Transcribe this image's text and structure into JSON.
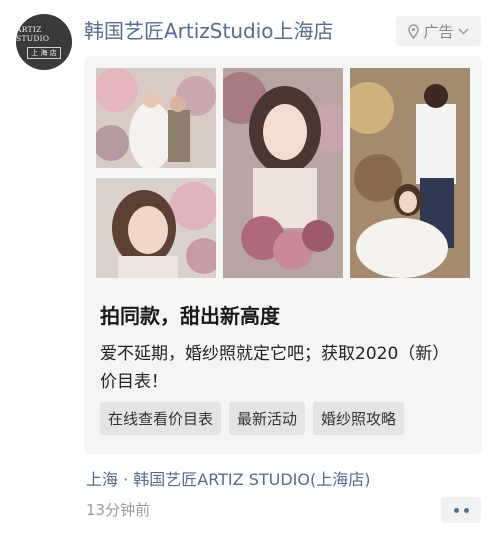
{
  "post": {
    "avatar_line1": "ARTIZ STUDIO",
    "avatar_line2": "上 海 店",
    "account_name": "韩国艺匠ArtizStudio上海店",
    "ad_label": "广告",
    "headline": "拍同款，甜出新高度",
    "description": "爱不延期，婚纱照就定它吧；获取2020（新）价目表！",
    "tags": [
      "在线查看价目表",
      "最新活动",
      "婚纱照攻略"
    ],
    "location": "上海 · 韩国艺匠ARTIZ STUDIO(上海店)",
    "time": "13分钟前"
  },
  "icons": {
    "badge": [
      "location-pin-icon",
      "chevron-down-icon"
    ],
    "menu": "more-dots-icon"
  },
  "colors": {
    "link_blue": "#576b95",
    "card_bg": "#f5f5f5",
    "tag_bg": "#e4e4e4"
  }
}
